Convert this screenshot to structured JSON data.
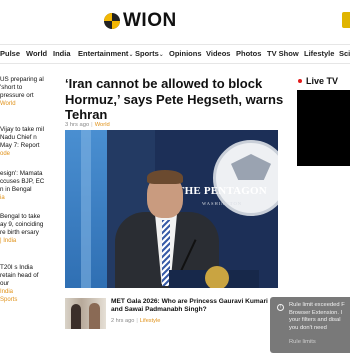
{
  "header": {
    "logo_text": "WION",
    "logo_icon": "wion-logo-icon"
  },
  "nav": {
    "items": [
      {
        "label": "Pulse",
        "has_dropdown": false
      },
      {
        "label": "World",
        "has_dropdown": false
      },
      {
        "label": "India",
        "has_dropdown": false
      },
      {
        "label": "Entertainment",
        "has_dropdown": true
      },
      {
        "label": "Sports",
        "has_dropdown": true
      },
      {
        "label": "Opinions",
        "has_dropdown": false
      },
      {
        "label": "Videos",
        "has_dropdown": false
      },
      {
        "label": "Photos",
        "has_dropdown": false
      },
      {
        "label": "TV Show",
        "has_dropdown": false
      },
      {
        "label": "Lifestyle",
        "has_dropdown": false
      },
      {
        "label": "Scie",
        "has_dropdown": false
      }
    ],
    "dropdown_icon": "⌄"
  },
  "left_stories": [
    {
      "title": "US preparing al 'short to pressure ort",
      "tag": "World"
    },
    {
      "title": "Vijay to take mil Nadu Chief n May 7: Report",
      "tag": "ode"
    },
    {
      "title": "esign': Mamata ccuses BJP, EC n in Bengal",
      "tag": "ia"
    },
    {
      "title": "Bengal to take ay 9, coinciding re birth ersary",
      "tag": "| India"
    },
    {
      "title": "T20I s India retain head of our",
      "tag": "India"
    },
    {
      "title": "",
      "tag": "Sports"
    }
  ],
  "article": {
    "headline": "‘Iran cannot be allowed to block Hormuz,’ says Pete Hegseth, warns Tehran",
    "time_ago": "3 hrs ago",
    "category": "World",
    "hero_sign_text": "THE PENTAGON",
    "hero_sign_sub": "WASHINGTON"
  },
  "story2": {
    "title": "MET Gala 2026: Who are Princess Gauravi Kumari and Sawai Padmanabh Singh?",
    "time_ago": "2 hrs ago",
    "category": "Lifestyle"
  },
  "live": {
    "label": "Live TV"
  },
  "toast": {
    "message": "Rule limit exceeded F Browser Extension. I your filters and disal you don't need",
    "link": "Rule limits",
    "icon_glyph": "!"
  },
  "colors": {
    "accent": "#e0921a",
    "live_dot": "#e21b1b"
  }
}
